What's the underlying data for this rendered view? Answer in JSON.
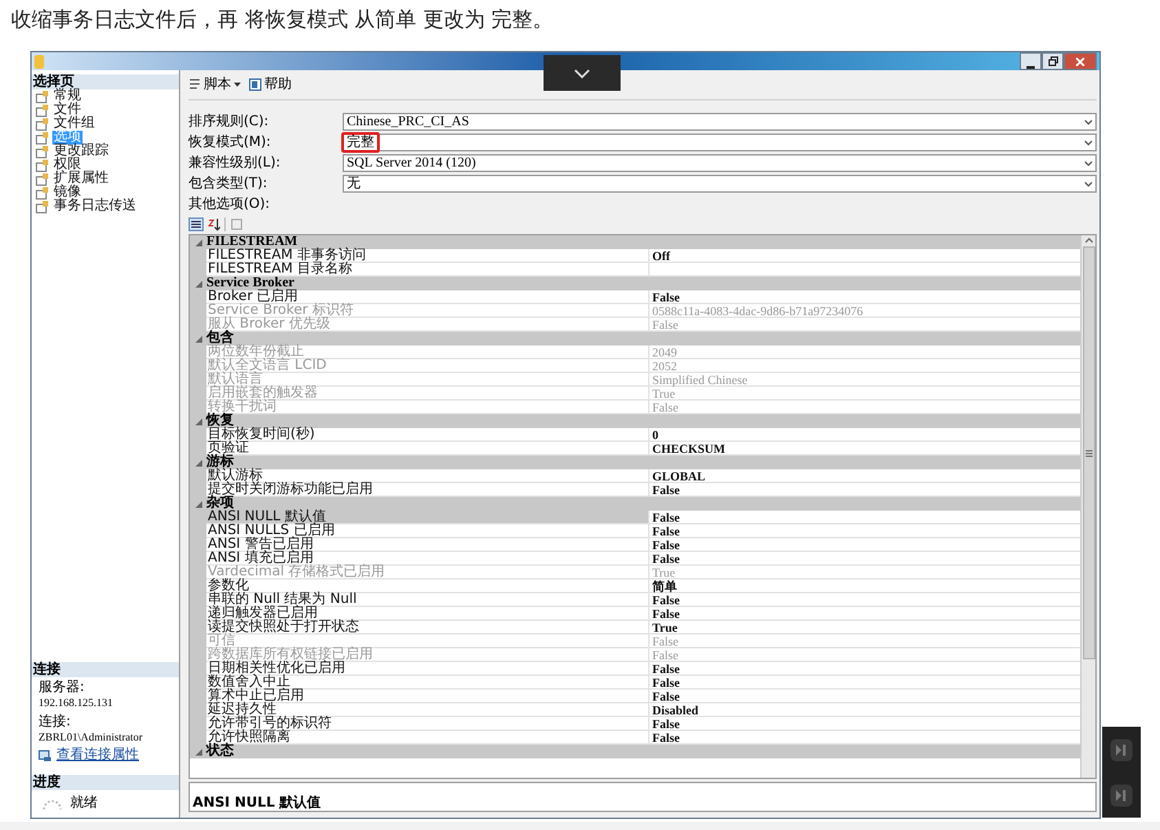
{
  "caption": "收缩事务日志文件后，再 将恢复模式 从简单 更改为 完整。",
  "sidebar": {
    "title": "选择页",
    "items": [
      {
        "label": "常规",
        "selected": false
      },
      {
        "label": "文件",
        "selected": false
      },
      {
        "label": "文件组",
        "selected": false
      },
      {
        "label": "选项",
        "selected": true
      },
      {
        "label": "更改跟踪",
        "selected": false
      },
      {
        "label": "权限",
        "selected": false
      },
      {
        "label": "扩展属性",
        "selected": false
      },
      {
        "label": "镜像",
        "selected": false
      },
      {
        "label": "事务日志传送",
        "selected": false
      }
    ],
    "connection": {
      "title": "连接",
      "server_label": "服务器:",
      "server": "192.168.125.131",
      "conn_label": "连接:",
      "conn": "ZBRL01\\Administrator",
      "link": "查看连接属性"
    },
    "progress": {
      "title": "进度",
      "status": "就绪"
    }
  },
  "toolbar": {
    "script": "脚本",
    "help": "帮助"
  },
  "fields": [
    {
      "label": "排序规则(C):",
      "value": "Chinese_PRC_CI_AS",
      "highlighted": false
    },
    {
      "label": "恢复模式(M):",
      "value": "完整",
      "highlighted": true
    },
    {
      "label": "兼容性级别(L):",
      "value": "SQL Server 2014 (120)",
      "highlighted": false
    },
    {
      "label": "包含类型(T):",
      "value": "无",
      "highlighted": false
    }
  ],
  "other_options_label": "其他选项(O):",
  "sections": [
    {
      "title": "FILESTREAM",
      "expanded": true,
      "rows": [
        {
          "name": "FILESTREAM 非事务访问",
          "value": "Off",
          "disabled": false,
          "selected": false
        },
        {
          "name": "FILESTREAM 目录名称",
          "value": "",
          "disabled": false,
          "selected": false
        }
      ]
    },
    {
      "title": "Service Broker",
      "expanded": true,
      "rows": [
        {
          "name": "Broker 已启用",
          "value": "False",
          "disabled": false,
          "selected": false
        },
        {
          "name": "Service Broker 标识符",
          "value": "0588c11a-4083-4dac-9d86-b71a97234076",
          "disabled": true,
          "selected": false
        },
        {
          "name": "服从 Broker 优先级",
          "value": "False",
          "disabled": true,
          "selected": false
        }
      ]
    },
    {
      "title": "包含",
      "expanded": true,
      "rows": [
        {
          "name": "两位数年份截止",
          "value": "2049",
          "disabled": true,
          "selected": false
        },
        {
          "name": "默认全文语言 LCID",
          "value": "2052",
          "disabled": true,
          "selected": false
        },
        {
          "name": "默认语言",
          "value": "Simplified Chinese",
          "disabled": true,
          "selected": false
        },
        {
          "name": "启用嵌套的触发器",
          "value": "True",
          "disabled": true,
          "selected": false
        },
        {
          "name": "转换干扰词",
          "value": "False",
          "disabled": true,
          "selected": false
        }
      ]
    },
    {
      "title": "恢复",
      "expanded": true,
      "rows": [
        {
          "name": "目标恢复时间(秒)",
          "value": "0",
          "disabled": false,
          "selected": false
        },
        {
          "name": "页验证",
          "value": "CHECKSUM",
          "disabled": false,
          "selected": false
        }
      ]
    },
    {
      "title": "游标",
      "expanded": true,
      "rows": [
        {
          "name": "默认游标",
          "value": "GLOBAL",
          "disabled": false,
          "selected": false
        },
        {
          "name": "提交时关闭游标功能已启用",
          "value": "False",
          "disabled": false,
          "selected": false
        }
      ]
    },
    {
      "title": "杂项",
      "expanded": true,
      "rows": [
        {
          "name": "ANSI NULL 默认值",
          "value": "False",
          "disabled": false,
          "selected": true
        },
        {
          "name": "ANSI NULLS 已启用",
          "value": "False",
          "disabled": false,
          "selected": false
        },
        {
          "name": "ANSI 警告已启用",
          "value": "False",
          "disabled": false,
          "selected": false
        },
        {
          "name": "ANSI 填充已启用",
          "value": "False",
          "disabled": false,
          "selected": false
        },
        {
          "name": "Vardecimal 存储格式已启用",
          "value": "True",
          "disabled": true,
          "selected": false
        },
        {
          "name": "参数化",
          "value": "简单",
          "disabled": false,
          "selected": false
        },
        {
          "name": "串联的 Null 结果为 Null",
          "value": "False",
          "disabled": false,
          "selected": false
        },
        {
          "name": "递归触发器已启用",
          "value": "False",
          "disabled": false,
          "selected": false
        },
        {
          "name": "读提交快照处于打开状态",
          "value": "True",
          "disabled": false,
          "selected": false
        },
        {
          "name": "可信",
          "value": "False",
          "disabled": true,
          "selected": false
        },
        {
          "name": "跨数据库所有权链接已启用",
          "value": "False",
          "disabled": true,
          "selected": false
        },
        {
          "name": "日期相关性优化已启用",
          "value": "False",
          "disabled": false,
          "selected": false
        },
        {
          "name": "数值舍入中止",
          "value": "False",
          "disabled": false,
          "selected": false
        },
        {
          "name": "算术中止已启用",
          "value": "False",
          "disabled": false,
          "selected": false
        },
        {
          "name": "延迟持久性",
          "value": "Disabled",
          "disabled": false,
          "selected": false
        },
        {
          "name": "允许带引号的标识符",
          "value": "False",
          "disabled": false,
          "selected": false
        },
        {
          "name": "允许快照隔离",
          "value": "False",
          "disabled": false,
          "selected": false
        }
      ]
    },
    {
      "title": "状态",
      "expanded": true
    }
  ],
  "description": "ANSI NULL 默认值"
}
